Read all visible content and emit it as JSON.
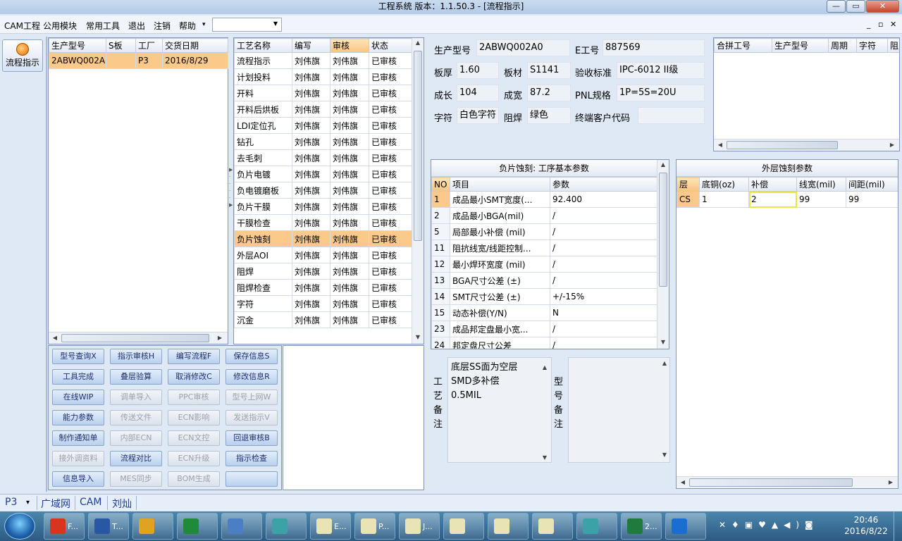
{
  "window": {
    "title": "工程系统   版本：1.1.50.3 - [流程指示]",
    "min_label": "—",
    "max_label": "▭",
    "close_label": "✕"
  },
  "menu": {
    "items": [
      "CAM工程",
      "公用模块",
      "常用工具",
      "退出",
      "注销",
      "帮助"
    ],
    "help_arrow": "▾",
    "combo_value": "",
    "mdi_min": "_",
    "mdi_restore": "▫",
    "mdi_close": "✕"
  },
  "left_nav": {
    "flow_button": "流程指示"
  },
  "part_grid": {
    "headers": [
      "生产型号",
      "S板",
      "工厂",
      "交货日期"
    ],
    "rows": [
      [
        "2ABWQ002A0",
        "",
        "P3",
        "2016/8/29"
      ]
    ]
  },
  "process_grid": {
    "headers": [
      "工艺名称",
      "编写",
      "审核",
      "状态"
    ],
    "rows": [
      [
        "流程指示",
        "刘伟旗",
        "刘伟旗",
        "已审核"
      ],
      [
        "计划投料",
        "刘伟旗",
        "刘伟旗",
        "已审核"
      ],
      [
        "开料",
        "刘伟旗",
        "刘伟旗",
        "已审核"
      ],
      [
        "开料后烘板",
        "刘伟旗",
        "刘伟旗",
        "已审核"
      ],
      [
        "LDI定位孔",
        "刘伟旗",
        "刘伟旗",
        "已审核"
      ],
      [
        "钻孔",
        "刘伟旗",
        "刘伟旗",
        "已审核"
      ],
      [
        "去毛刺",
        "刘伟旗",
        "刘伟旗",
        "已审核"
      ],
      [
        "负片电镀",
        "刘伟旗",
        "刘伟旗",
        "已审核"
      ],
      [
        "负电镀磨板",
        "刘伟旗",
        "刘伟旗",
        "已审核"
      ],
      [
        "负片干膜",
        "刘伟旗",
        "刘伟旗",
        "已审核"
      ],
      [
        "干膜检查",
        "刘伟旗",
        "刘伟旗",
        "已审核"
      ],
      [
        "负片蚀刻",
        "刘伟旗",
        "刘伟旗",
        "已审核"
      ],
      [
        "外层AOI",
        "刘伟旗",
        "刘伟旗",
        "已审核"
      ],
      [
        "阻焊",
        "刘伟旗",
        "刘伟旗",
        "已审核"
      ],
      [
        "阻焊检查",
        "刘伟旗",
        "刘伟旗",
        "已审核"
      ],
      [
        "字符",
        "刘伟旗",
        "刘伟旗",
        "已审核"
      ],
      [
        "沉金",
        "刘伟旗",
        "刘伟旗",
        "已审核"
      ]
    ]
  },
  "buttons": [
    "型号查询X",
    "指示审核H",
    "编写流程F",
    "保存信息S",
    "工具完成",
    "叠层验算",
    "取消修改C",
    "修改信息R",
    "在线WIP",
    "调单导入",
    "PPC审核",
    "型号上网W",
    "能力参数",
    "传送文件",
    "ECN影响",
    "发送指示V",
    "制作通知单",
    "内部ECN",
    "ECN文控",
    "回退审核B",
    "接外调资料",
    "流程对比",
    "ECN升级",
    "指示检查",
    "信息导入",
    "MES同步",
    "BOM生成",
    ""
  ],
  "info": {
    "labels": {
      "part_no": "生产型号",
      "e_no": "E工号",
      "thickness": "板厚",
      "material": "板材",
      "standard": "验收标准",
      "length": "成长",
      "width": "成宽",
      "pnl": "PNL规格",
      "legend": "字符",
      "mask": "阻焊",
      "customer_code": "终端客户代码"
    },
    "values": {
      "part_no": "2ABWQ002A0",
      "e_no": "887569",
      "thickness": "1.60",
      "material": "S1141",
      "standard": "IPC-6012 II级",
      "length": "104",
      "width": "87.2",
      "pnl": "1P=5S=20U",
      "legend": "白色字符",
      "mask": "绿色",
      "customer_code": ""
    }
  },
  "merge_grid": {
    "headers": [
      "合拼工号",
      "生产型号",
      "周期",
      "字符",
      "阻"
    ]
  },
  "etch_params": {
    "title": "负片蚀刻: 工序基本参数",
    "headers": [
      "NO",
      "项目",
      "参数"
    ],
    "rows": [
      [
        "1",
        "成品最小SMT宽度(...",
        "92.400"
      ],
      [
        "2",
        "成品最小BGA(mil)",
        "/"
      ],
      [
        "5",
        "局部最小补偿 (mil)",
        "/"
      ],
      [
        "11",
        "阻抗线宽/线距控制...",
        "/"
      ],
      [
        "12",
        "最小焊环宽度 (mil)",
        "/"
      ],
      [
        "13",
        "BGA尺寸公差 (±)",
        "/"
      ],
      [
        "14",
        "SMT尺寸公差 (±)",
        "+/-15%"
      ],
      [
        "15",
        "动态补偿(Y/N)",
        "N"
      ],
      [
        "23",
        "成品邦定盘最小宽...",
        "/"
      ],
      [
        "24",
        "邦定盘尺寸公差",
        "/"
      ]
    ]
  },
  "outer_etch": {
    "title": "外层蚀刻参数",
    "headers": [
      "层",
      "底铜(oz)",
      "补偿",
      "线宽(mil)",
      "间距(mil)"
    ],
    "rows": [
      [
        "CS",
        "1",
        "2",
        "99",
        "99"
      ]
    ]
  },
  "remarks": {
    "process_label": [
      "工",
      "艺",
      "备",
      "注"
    ],
    "process_text": [
      "底层SS面为空层",
      "SMD多补偿",
      "0.5MIL"
    ],
    "model_label": [
      "型",
      "号",
      "备",
      "注"
    ],
    "model_text": ""
  },
  "status": {
    "factory": "P3",
    "factory_arrow": "▾",
    "items": [
      "广域网",
      "CAM",
      "刘灿"
    ]
  },
  "taskbar": {
    "apps": [
      "F...",
      "T...",
      "",
      "",
      "",
      "",
      "E...",
      "P...",
      "J...",
      "",
      "",
      "",
      "",
      "2...",
      ""
    ],
    "time": "20:46",
    "date": "2016/8/22"
  },
  "colors": {
    "selected_row": "#fbc98a",
    "highlight_border": "#e8e84a",
    "accent": "#1f3f9a"
  }
}
